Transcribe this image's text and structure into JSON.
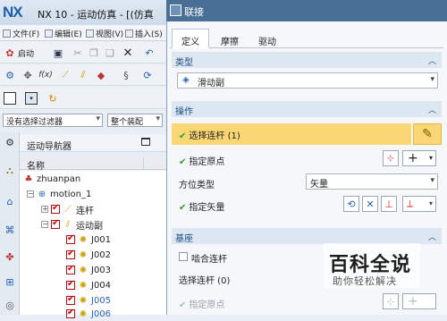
{
  "app": {
    "logo": "NX",
    "title": "NX 10 - 运动仿真 - [(仿真",
    "menus": [
      "文件(F)",
      "编辑(E)",
      "视图(V)",
      "插入(S)"
    ],
    "start_label": "启动",
    "filter_value": "没有选择过滤器",
    "assembly_value": "整个装配"
  },
  "navigator": {
    "title": "运动导航器",
    "column_name": "名称",
    "items": [
      "zhuanpan",
      "motion_1",
      "连杆",
      "运动副",
      "J001",
      "J002",
      "J003",
      "J004",
      "J005",
      "J006"
    ]
  },
  "dialog": {
    "title": "联接",
    "tabs": [
      "定义",
      "摩擦",
      "驱动"
    ],
    "type_group": "类型",
    "type_value": "滑动副",
    "op_group": "操作",
    "select_link": "选择连杆 (1)",
    "specify_origin": "指定原点",
    "orient_type_label": "方位类型",
    "orient_type_value": "矢量",
    "specify_vector": "指定矢量",
    "base_group": "基座",
    "mesh_link": "啮合连杆",
    "base_select_link": "选择连杆 (0)",
    "base_specify_origin": "指定原点"
  },
  "watermark": {
    "title": "百科全说",
    "subtitle": "助你轻松解决"
  }
}
